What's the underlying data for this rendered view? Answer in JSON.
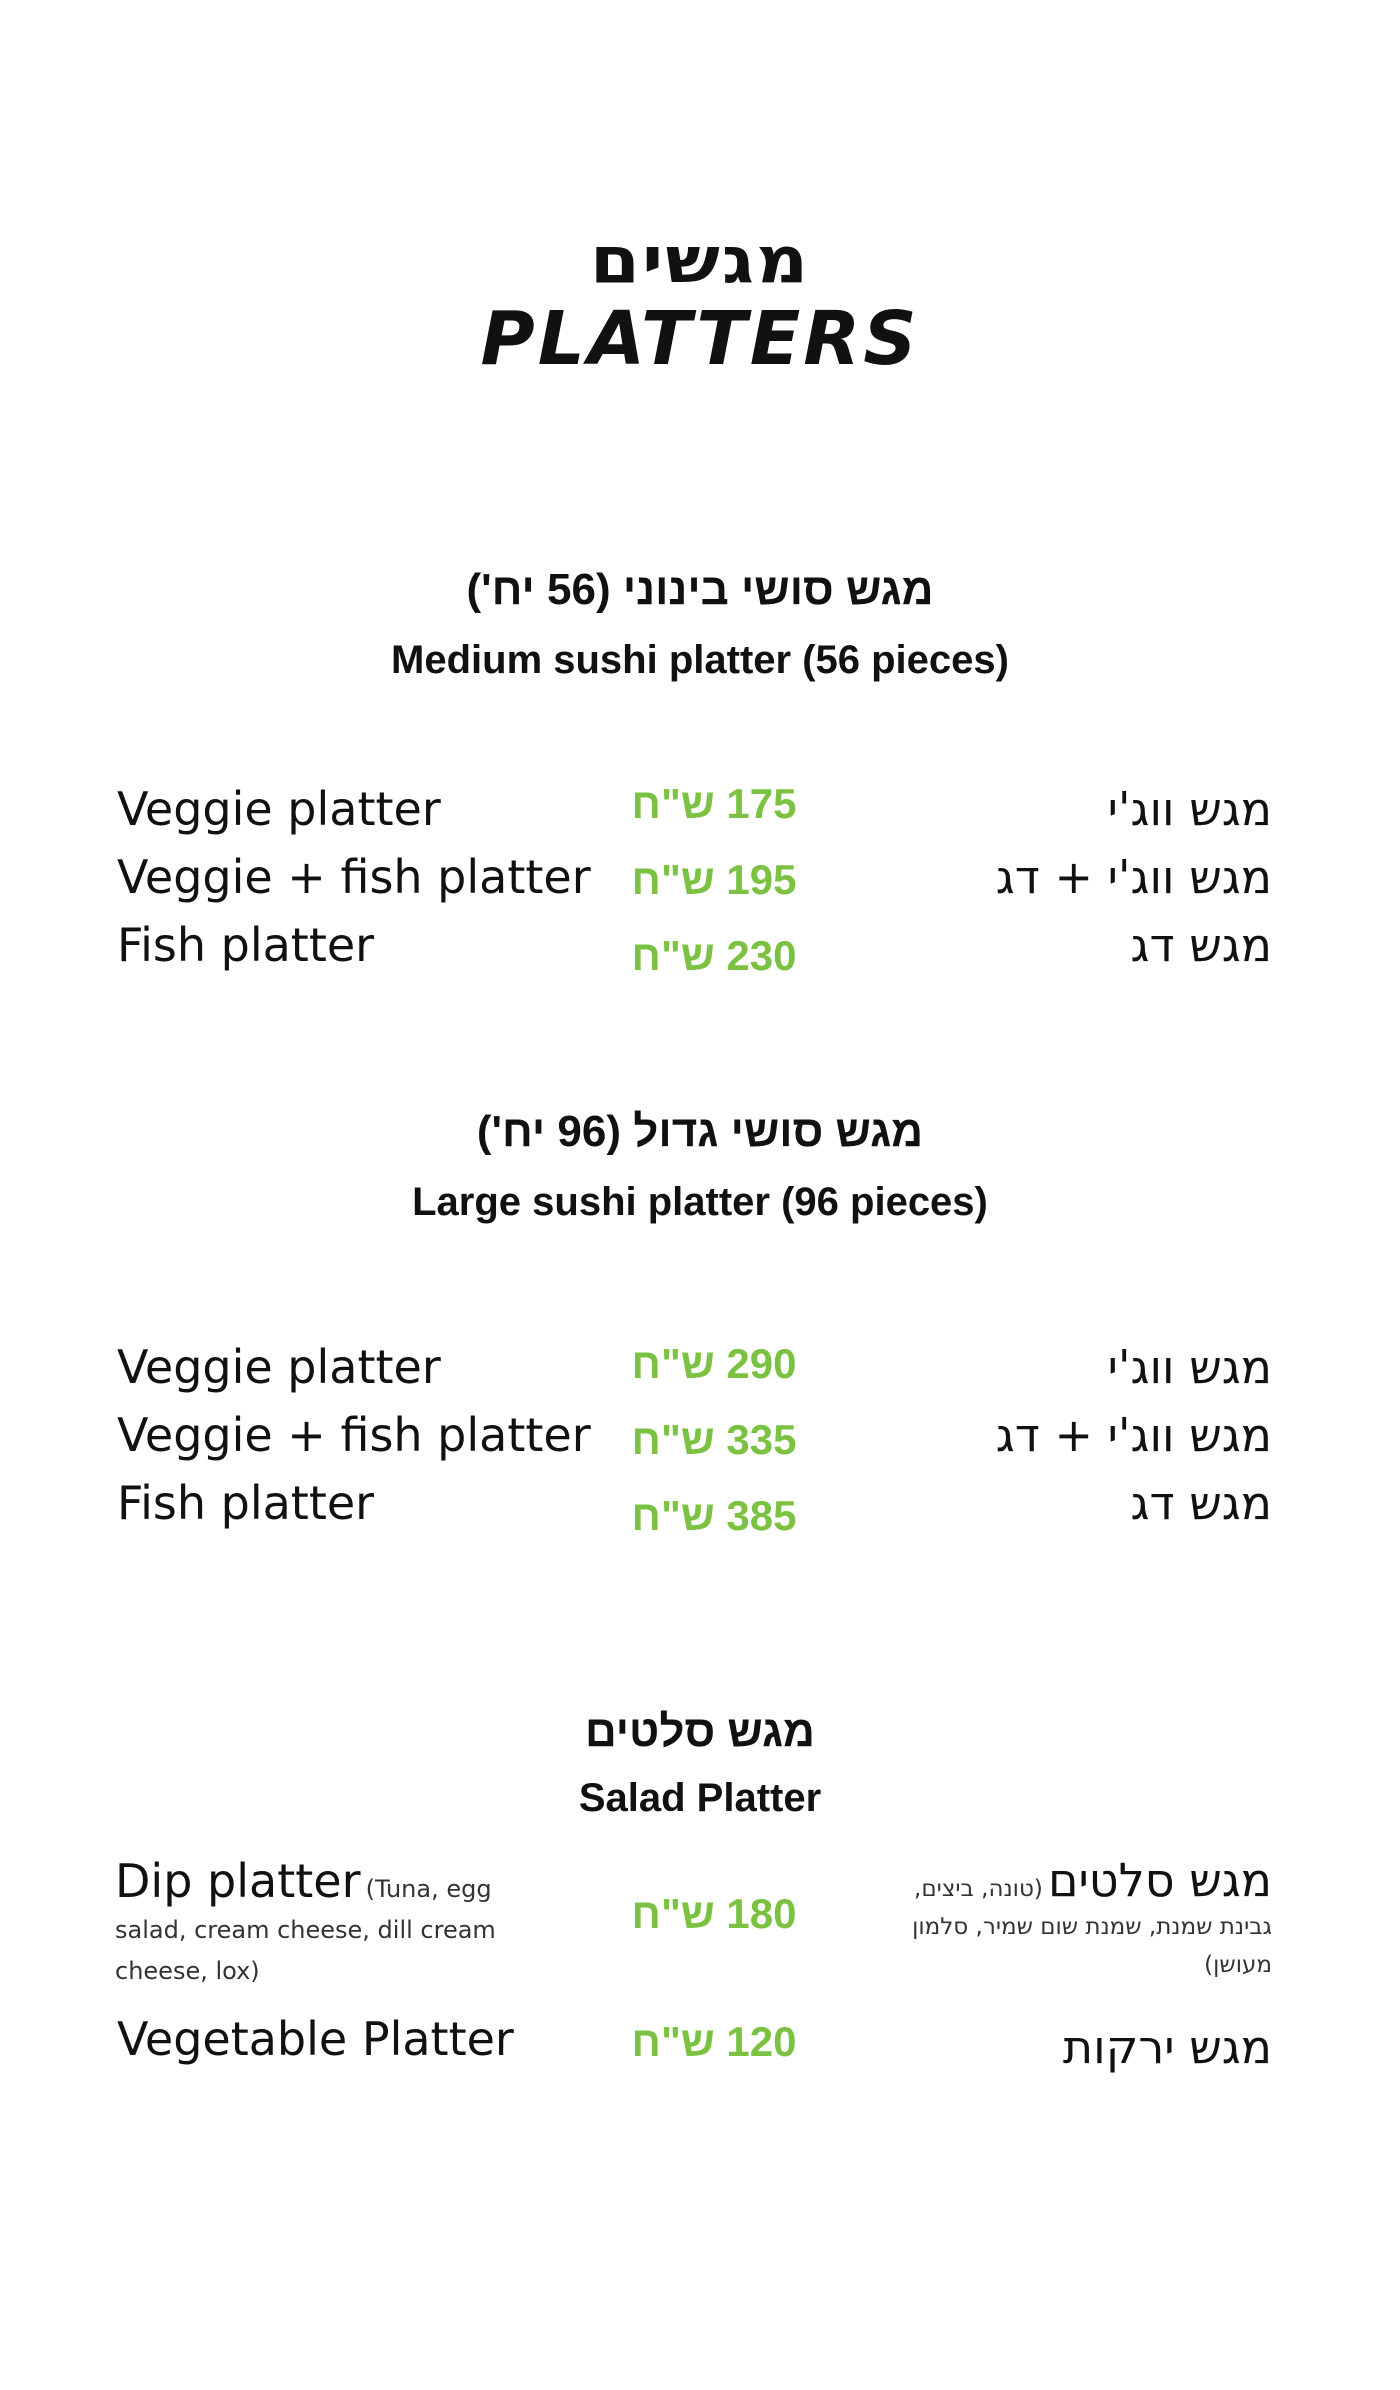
{
  "header": {
    "title_he": "מגשים",
    "title_en": "PLATTERS"
  },
  "sections": [
    {
      "title_he": "מגש סושי בינוני (56 יח')",
      "title_en": "Medium sushi platter (56 pieces)",
      "items": [
        {
          "name_en": "Veggie platter",
          "price": "175 ש\"ח",
          "name_he": "מגש ווג'י"
        },
        {
          "name_en": "Veggie + fish platter",
          "price": "195 ש\"ח",
          "name_he": "מגש ווג'י + דג"
        },
        {
          "name_en": "Fish platter",
          "price": "230 ש\"ח",
          "name_he": "מגש דג"
        }
      ]
    },
    {
      "title_he": "מגש סושי גדול (96 יח')",
      "title_en": "Large sushi platter (96 pieces)",
      "items": [
        {
          "name_en": "Veggie platter",
          "price": "290 ש\"ח",
          "name_he": "מגש ווג'י"
        },
        {
          "name_en": "Veggie + fish platter",
          "price": "335 ש\"ח",
          "name_he": "מגש ווג'י + דג"
        },
        {
          "name_en": "Fish platter",
          "price": "385 ש\"ח",
          "name_he": "מגש דג"
        }
      ]
    },
    {
      "title_he": "מגש סלטים",
      "title_en": "Salad Platter",
      "items": [
        {
          "name_en": "Dip platter",
          "note_en": "(Tuna, egg salad, cream cheese, dill cream cheese, lox)",
          "price": "180 ש\"ח",
          "name_he": "מגש סלטים",
          "note_he": "(טונה, ביצים, גבינת שמנת, שמנת שום שמיר, סלמון מעושן)"
        },
        {
          "name_en": "Vegetable Platter",
          "price": "120 ש\"ח",
          "name_he": "מגש ירקות"
        }
      ]
    }
  ],
  "colors": {
    "price": "#7cc242",
    "text": "#111111",
    "background": "#ffffff"
  }
}
